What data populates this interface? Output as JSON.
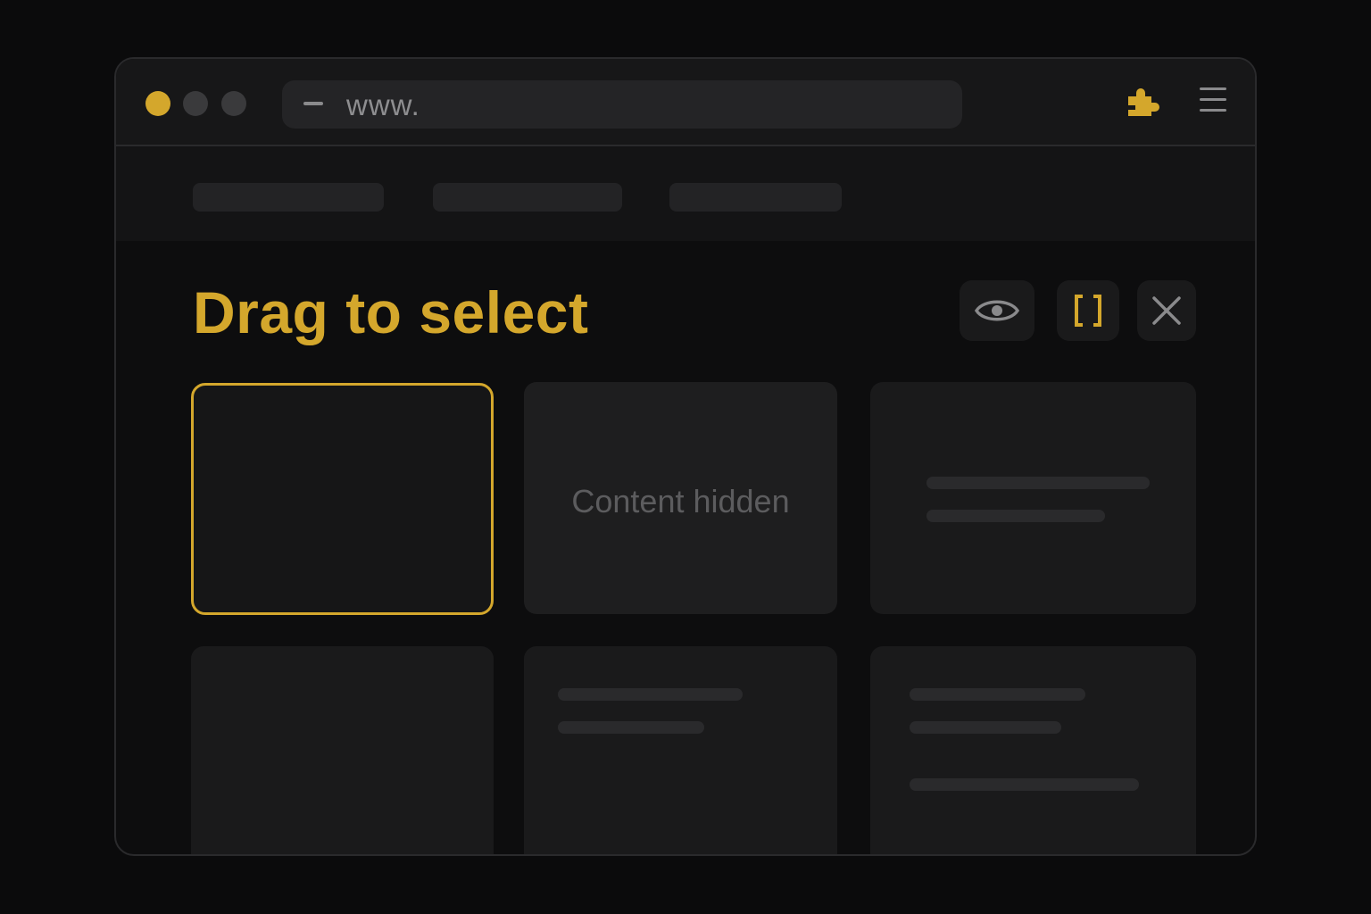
{
  "browser": {
    "url_text": "www.",
    "window_controls": [
      "close",
      "minimize",
      "maximize"
    ],
    "extension_icon": "puzzle-icon",
    "menu_icon": "hamburger-menu-icon",
    "nav_items": [
      "",
      "",
      ""
    ]
  },
  "overlay": {
    "title": "Drag to select",
    "toolbar": {
      "preview_icon": "eye-icon",
      "select_icon": "brackets-icon",
      "close_icon": "close-icon"
    }
  },
  "cards": [
    {
      "state": "selected",
      "text": ""
    },
    {
      "state": "hidden",
      "text": "Content hidden"
    },
    {
      "state": "placeholder",
      "text": ""
    },
    {
      "state": "placeholder",
      "text": ""
    },
    {
      "state": "placeholder",
      "text": ""
    },
    {
      "state": "placeholder",
      "text": ""
    }
  ],
  "colors": {
    "accent": "#d4a72c",
    "background": "#0b0b0c",
    "card": "#1a1a1b",
    "muted_text": "#5c5c5e"
  }
}
